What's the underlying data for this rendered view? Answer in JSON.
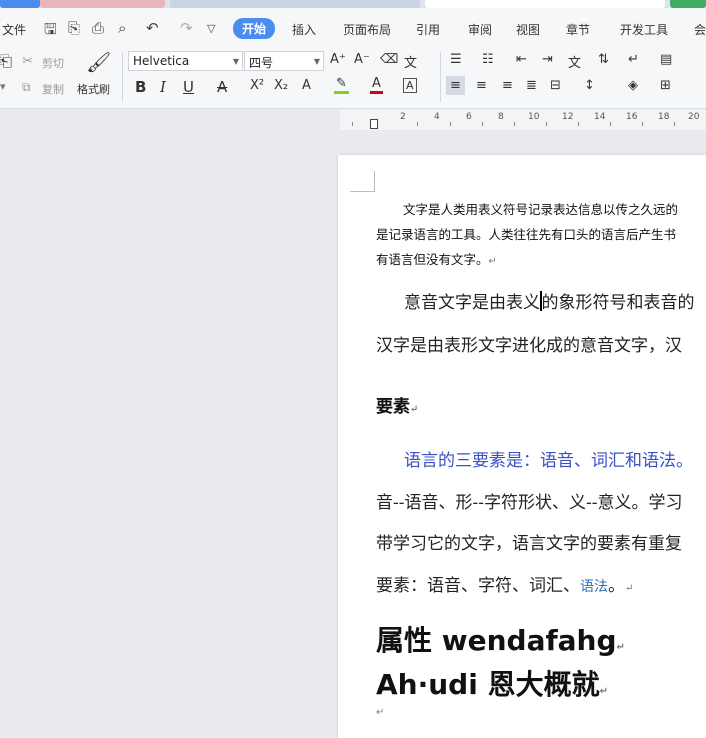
{
  "ribbon": {
    "file_label": "文件",
    "tabs": [
      "开始",
      "插入",
      "页面布局",
      "引用",
      "审阅",
      "视图",
      "章节",
      "开发工具",
      "会"
    ],
    "active_tab": "开始"
  },
  "clipboard": {
    "cut": "剪切",
    "copy": "复制",
    "format_painter": "格式刷"
  },
  "font": {
    "family": "Helvetica",
    "size": "四号"
  },
  "ruler": {
    "numbers": [
      "2",
      "4",
      "6",
      "8",
      "10",
      "12",
      "14",
      "16",
      "18",
      "20"
    ]
  },
  "document": {
    "p1_line1": "文字是人类用表义符号记录表达信息以传之久远的",
    "p1_line2": "是记录语言的工具。人类往往先有口头的语言后产生书",
    "p1_line3": "有语言但没有文字。",
    "p2_before_caret": "意音文字是由表义",
    "p2_after_caret": "的象形符号和表音的",
    "p3": "汉字是由表形文字进化成的意音文字，汉",
    "heading": "要素",
    "p4": "语言的三要素是：语音、词汇和语法。",
    "p5": "音--语音、形--字符形状、义--意义。学习",
    "p6": "带学习它的文字，语言文字的要素有重复",
    "p7_prefix": "要素：语音、字符、词汇、",
    "p7_link": "语法",
    "p7_suffix": "。",
    "big1": "属性 wendafahg",
    "big2": "Ah·udi 恩大概就"
  },
  "colors": {
    "accent": "#4a8cf0",
    "blue_text": "#3a4fc8",
    "link": "#2e6fb5"
  }
}
